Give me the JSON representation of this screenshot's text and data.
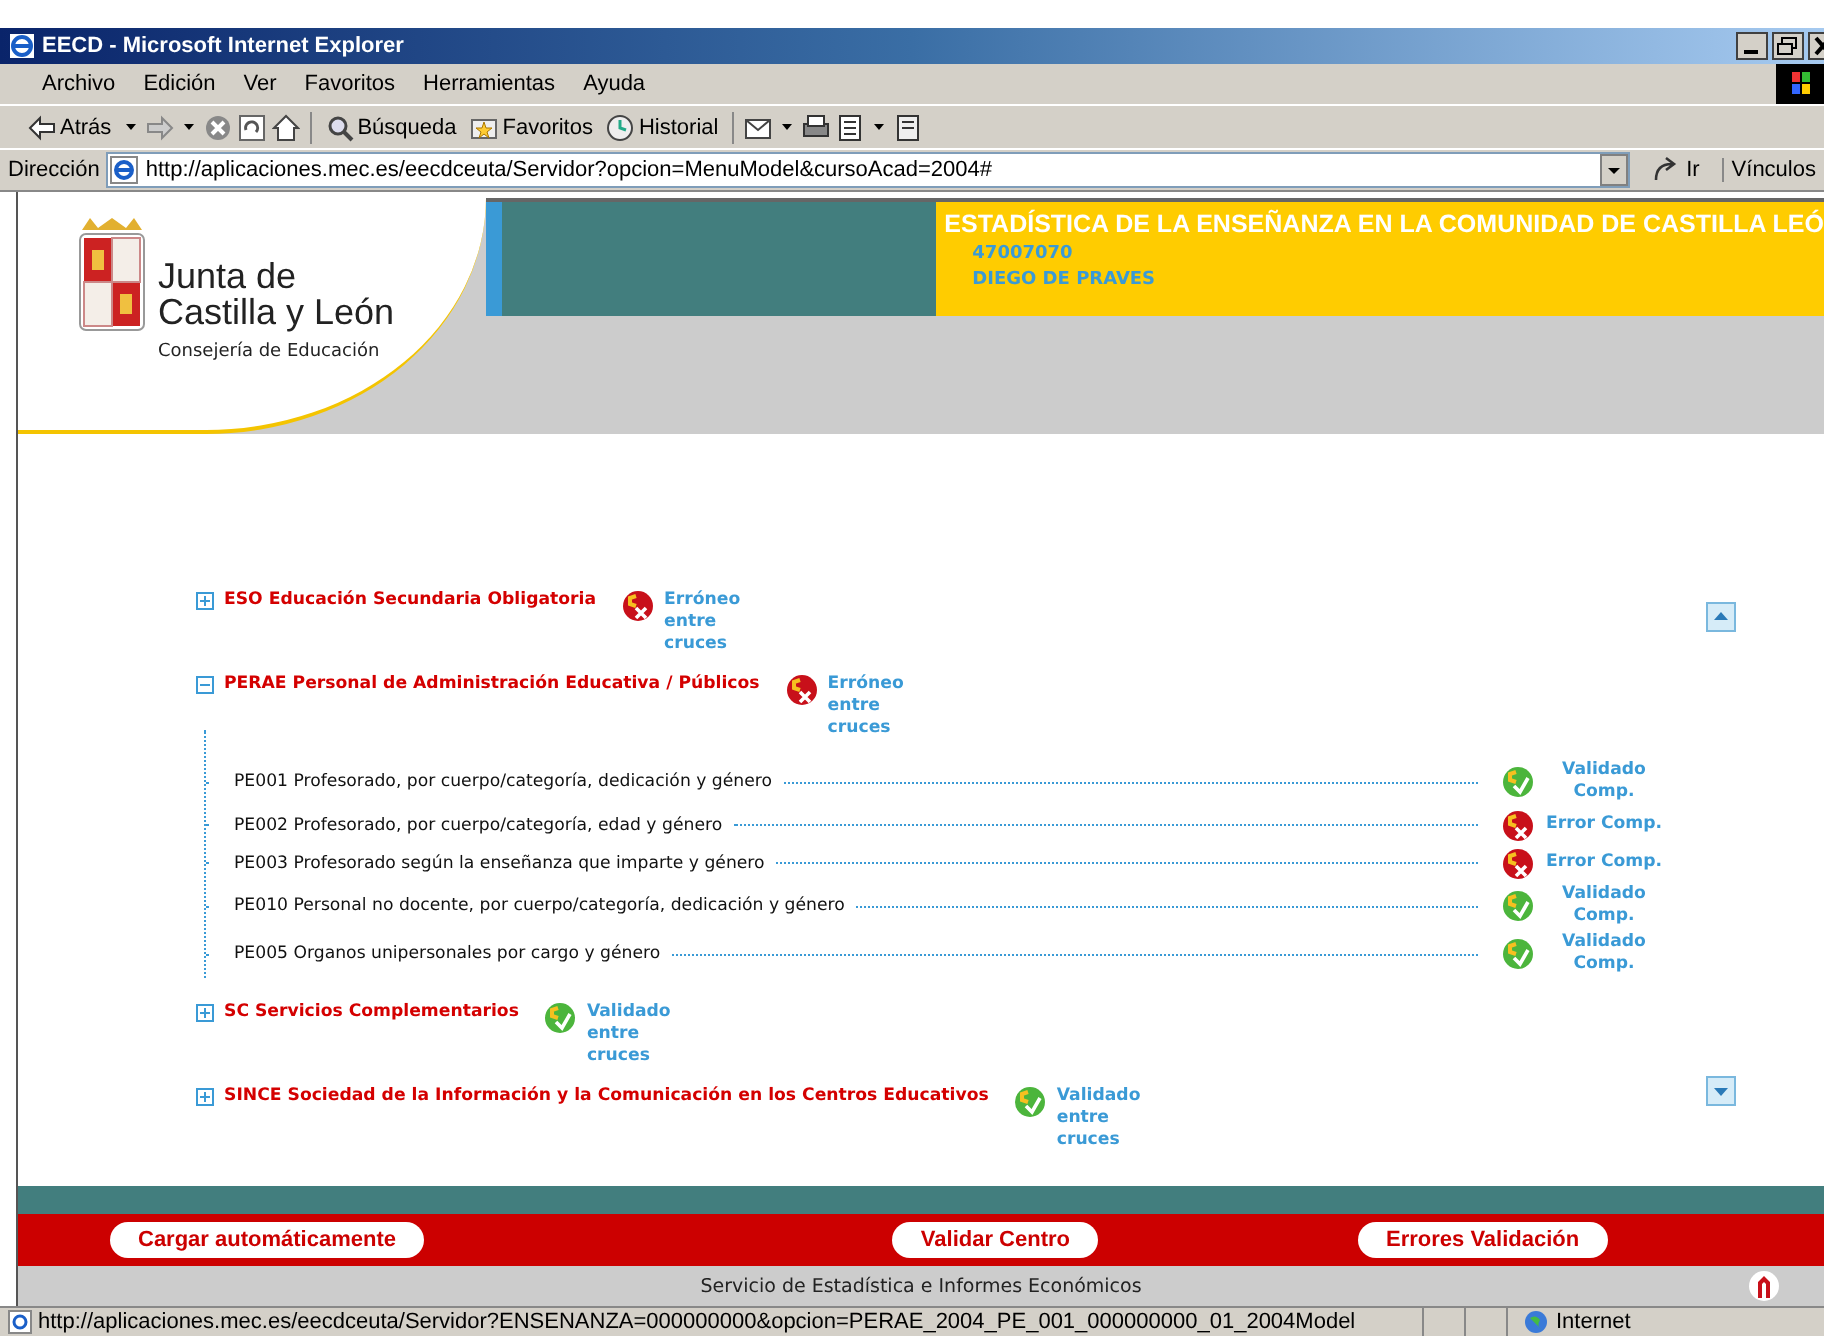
{
  "window": {
    "title": "EECD - Microsoft Internet Explorer"
  },
  "menu": [
    "Archivo",
    "Edición",
    "Ver",
    "Favoritos",
    "Herramientas",
    "Ayuda"
  ],
  "toolbar": [
    {
      "kind": "back",
      "label": "Atrás"
    },
    {
      "kind": "forward"
    },
    {
      "kind": "stop"
    },
    {
      "kind": "refresh"
    },
    {
      "kind": "home"
    },
    {
      "kind": "search",
      "label": "Búsqueda"
    },
    {
      "kind": "favorites",
      "label": "Favoritos"
    },
    {
      "kind": "history",
      "label": "Historial"
    },
    {
      "kind": "mail"
    },
    {
      "kind": "print"
    },
    {
      "kind": "edit"
    },
    {
      "kind": "discuss"
    }
  ],
  "address": {
    "label": "Dirección",
    "url": "http://aplicaciones.mec.es/eecdceuta/Servidor?opcion=MenuModel&cursoAcad=2004#",
    "go": "Ir",
    "links": "Vínculos"
  },
  "header": {
    "org_line_1": "Junta de",
    "org_line_2": "Castilla y León",
    "department": "Consejería de Educación",
    "banner": "ESTADÍSTICA DE LA ENSEÑANZA EN LA COMUNIDAD DE CASTILLA LEÓ",
    "center_code": "47007070",
    "center_name": "DIEGO DE PRAVES"
  },
  "tree": [
    {
      "label": "ESO Educación Secundaria Obligatoria",
      "expanded": false,
      "status": {
        "kind": "error",
        "text": "Erróneo entre cruces"
      }
    },
    {
      "label": "PERAE Personal de Administración Educativa / Públicos",
      "expanded": true,
      "status": {
        "kind": "error",
        "text": "Erróneo entre cruces"
      },
      "children": [
        {
          "label": "PE001 Profesorado, por cuerpo/categoría, dedicación y género",
          "status": {
            "kind": "valid",
            "text": "Validado Comp."
          }
        },
        {
          "label": "PE002 Profesorado, por cuerpo/categoría, edad y género",
          "status": {
            "kind": "error",
            "text": "Error Comp."
          }
        },
        {
          "label": "PE003 Profesorado según la enseñanza que imparte y género",
          "status": {
            "kind": "error",
            "text": "Error Comp."
          }
        },
        {
          "label": "PE010 Personal no docente, por cuerpo/categoría, dedicación y género",
          "status": {
            "kind": "valid",
            "text": "Validado Comp."
          }
        },
        {
          "label": "PE005 Organos unipersonales por cargo y género",
          "status": {
            "kind": "valid",
            "text": "Validado Comp."
          }
        }
      ]
    },
    {
      "label": "SC Servicios Complementarios",
      "expanded": false,
      "status": {
        "kind": "valid",
        "text": "Validado entre cruces"
      }
    },
    {
      "label": "SINCE Sociedad de la Información y la Comunicación en los Centros Educativos",
      "expanded": false,
      "status": {
        "kind": "valid",
        "text": "Validado entre cruces"
      }
    }
  ],
  "buttons": [
    "Cargar automáticamente",
    "Validar Centro",
    "Errores Validación"
  ],
  "footer": "Servicio de Estadística e Informes Económicos",
  "status_bar": {
    "text": "http://aplicaciones.mec.es/eecdceuta/Servidor?ENSENANZA=000000000&opcion=PERAE_2004_PE_001_000000000_01_2004Model",
    "zone": "Internet"
  }
}
